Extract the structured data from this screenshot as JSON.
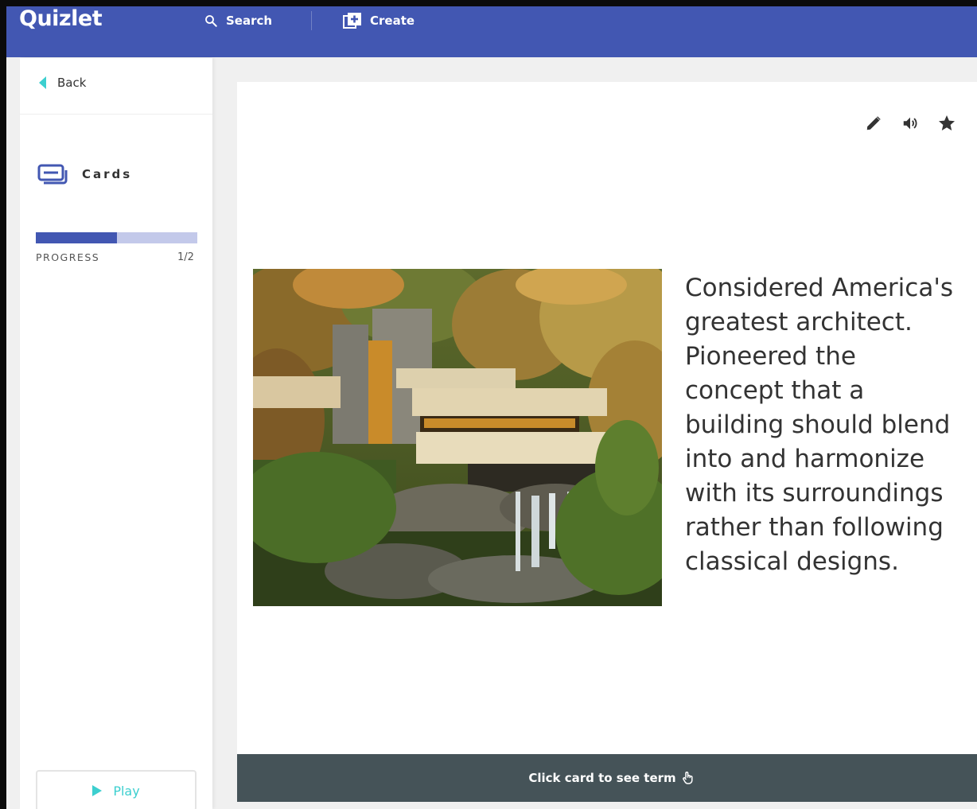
{
  "app": {
    "logo": "Quizlet"
  },
  "topbar": {
    "search_label": "Search",
    "create_label": "Create",
    "icons": {
      "search": "search-icon",
      "create": "add-box-icon"
    }
  },
  "sidebar": {
    "back_label": "Back",
    "mode_label": "Cards",
    "mode_icon": "cards-icon",
    "progress_label": "PROGRESS",
    "progress_count": "1/2",
    "progress_value": 0.5,
    "play_label": "Play"
  },
  "card": {
    "definition": "Considered America's greatest architect. Pioneered the concept that a building should blend into and harmonize with its surroundings rather than following classical designs.",
    "tools": [
      "edit-icon",
      "audio-icon",
      "star-icon"
    ],
    "footer_label": "Click card to see term"
  },
  "colors": {
    "brand": "#4257b2",
    "accent": "#3ccfcf",
    "progress_track": "#c3c9ea",
    "footer_bg": "#455358"
  }
}
